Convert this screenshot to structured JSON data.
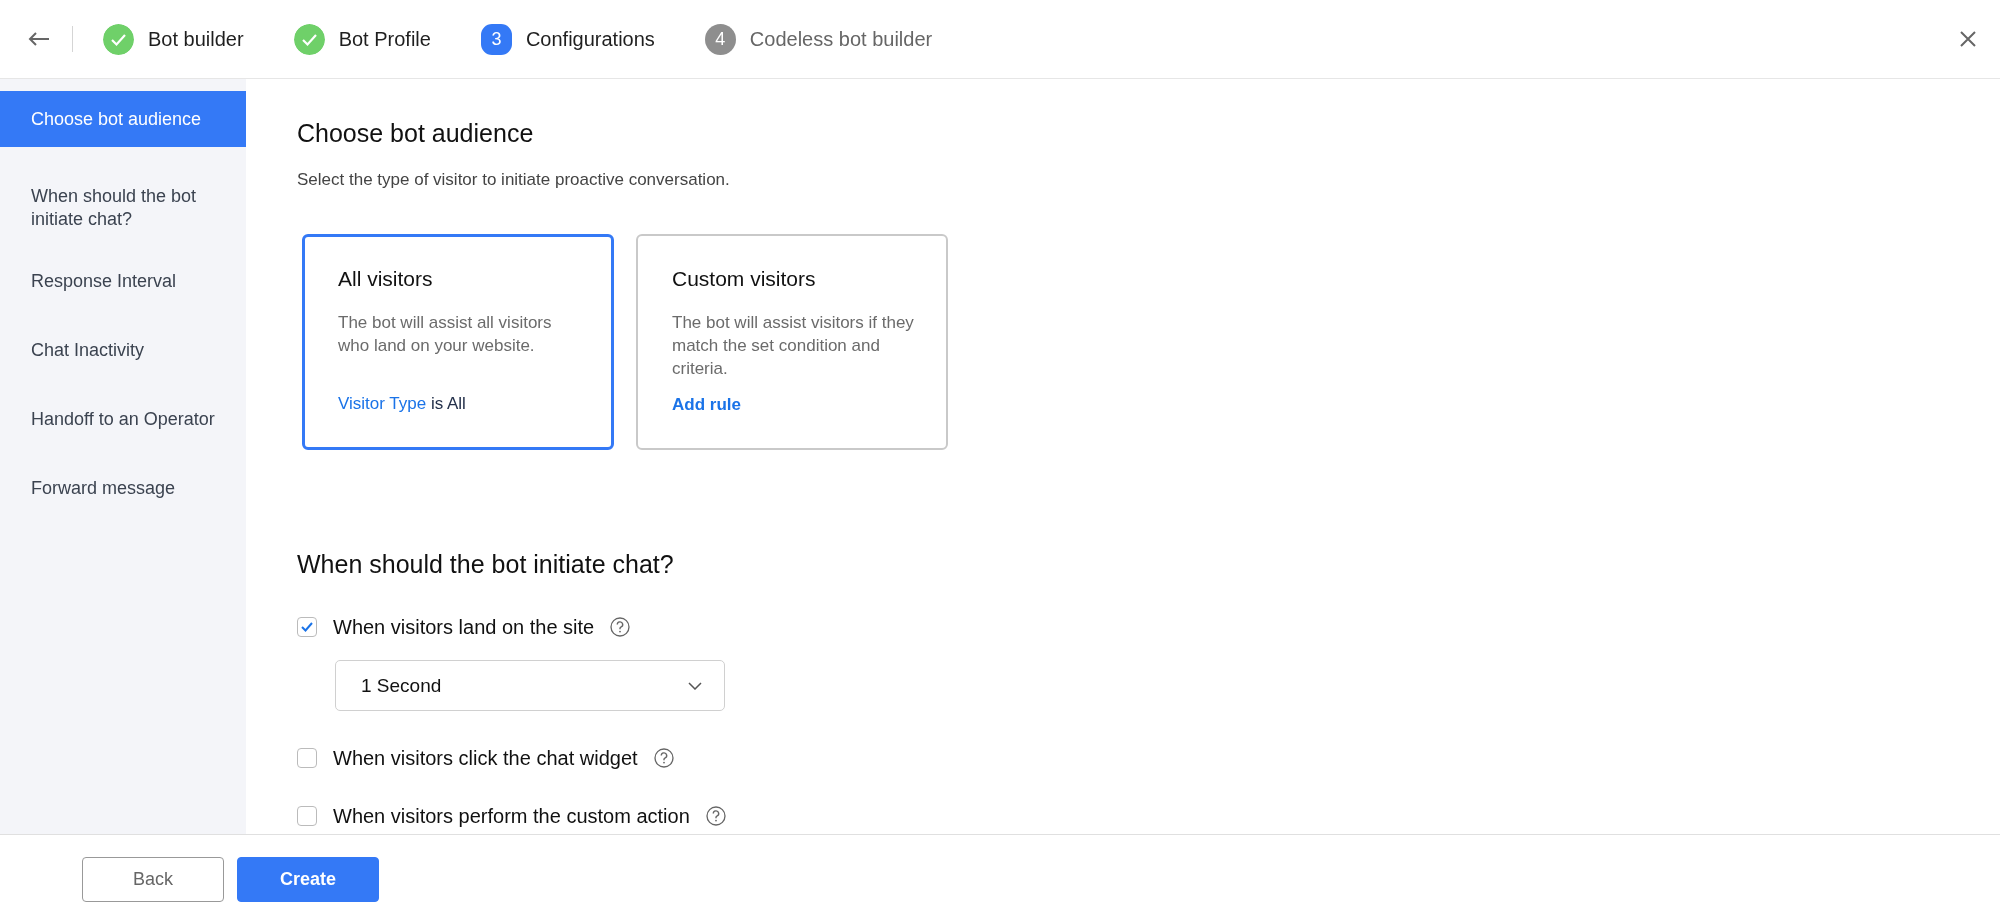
{
  "header": {
    "steps": [
      {
        "label": "Bot builder",
        "kind": "done"
      },
      {
        "label": "Bot Profile",
        "kind": "done"
      },
      {
        "number": "3",
        "label": "Configurations",
        "kind": "current"
      },
      {
        "number": "4",
        "label": "Codeless bot builder",
        "kind": "pending"
      }
    ]
  },
  "sidebar": {
    "items": [
      {
        "label": "Choose bot audience",
        "selected": true
      },
      {
        "label": "When should the bot initiate chat?",
        "selected": false
      },
      {
        "label": "Response Interval",
        "selected": false
      },
      {
        "label": "Chat Inactivity",
        "selected": false
      },
      {
        "label": "Handoff to an Operator",
        "selected": false
      },
      {
        "label": "Forward message",
        "selected": false
      }
    ]
  },
  "audience": {
    "title": "Choose bot audience",
    "subtitle": "Select the type of visitor to initiate proactive conversation.",
    "cards": [
      {
        "title": "All visitors",
        "description": "The bot will assist all visitors who land on your website.",
        "link": "Visitor Type",
        "link_suffix": " is All",
        "selected": true
      },
      {
        "title": "Custom visitors",
        "description": "The bot will assist visitors if they match the set condition and criteria.",
        "link": "Add rule",
        "selected": false
      }
    ]
  },
  "initiate": {
    "title": "When should the bot initiate chat?",
    "options": [
      {
        "label": "When visitors land on the site",
        "checked": true,
        "dropdown": {
          "value": "1 Second"
        }
      },
      {
        "label": "When visitors click the chat widget",
        "checked": false
      },
      {
        "label": "When visitors perform the custom action",
        "checked": false
      }
    ]
  },
  "footer": {
    "buttons": [
      {
        "label": "Back",
        "kind": "secondary"
      },
      {
        "label": "Create",
        "kind": "primary"
      }
    ]
  }
}
